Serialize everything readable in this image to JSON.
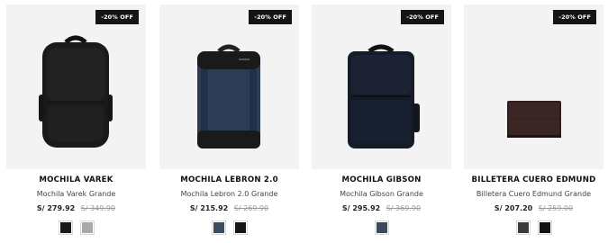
{
  "products": [
    {
      "badge": "-20% OFF",
      "name": "MOCHILA VAREK",
      "subtitle": "Mochila Varek Grande",
      "price": "S/ 279.92",
      "old_price": "S/ 349.90",
      "image": "black-backpack",
      "swatches": [
        "#1b1b1b",
        "#a9a9ad"
      ]
    },
    {
      "badge": "-20% OFF",
      "name": "MOCHILA LEBRON 2.0",
      "subtitle": "Mochila Lebron 2.0 Grande",
      "price": "S/ 215.92",
      "old_price": "S/ 269.90",
      "image": "navy-backpack",
      "swatches": [
        "#3b4b63",
        "#161616"
      ]
    },
    {
      "badge": "-20% OFF",
      "name": "MOCHILA GIBSON",
      "subtitle": "Mochila Gibson Grande",
      "price": "S/ 295.92",
      "old_price": "S/ 369.90",
      "image": "dark-navy-backpack",
      "swatches": [
        "#3d4a5e"
      ]
    },
    {
      "badge": "-20% OFF",
      "name": "BILLETERA CUERO EDMUND",
      "subtitle": "Billetera Cuero Edmund Grande",
      "price": "S/ 207.20",
      "old_price": "S/ 259.00",
      "image": "brown-wallet",
      "swatches": [
        "#3b3b3b",
        "#121212"
      ]
    }
  ]
}
